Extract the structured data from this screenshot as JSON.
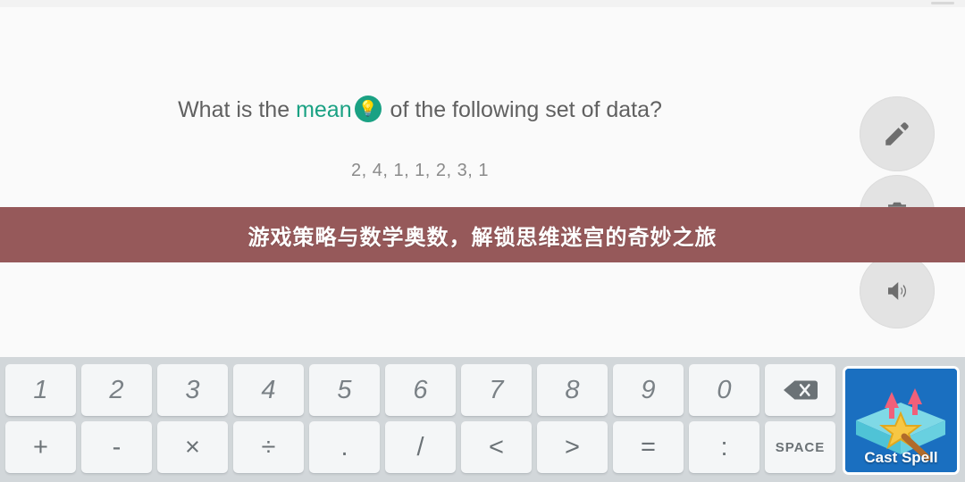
{
  "app": {
    "banner_text": "游戏策略与数学奥数，解锁思维迷宫的奇妙之旅",
    "banner_color": "#96595a",
    "accent_color": "#1aa183",
    "keypad_bg": "#d2d7da"
  },
  "question": {
    "prefix": "What is the ",
    "keyword": "mean",
    "suffix": " of the following set of data?",
    "hint_icon": "lightbulb-icon",
    "data_set": "2, 4, 1, 1, 2, 3, 1"
  },
  "answer": {
    "value": "",
    "placeholder": "",
    "hint_icon": "lightbulb-icon"
  },
  "side_actions": [
    {
      "name": "edit-button",
      "icon": "pencil-icon"
    },
    {
      "name": "delete-button",
      "icon": "trash-icon"
    },
    {
      "name": "sound-button",
      "icon": "speaker-icon"
    }
  ],
  "keypad": {
    "row1": [
      "1",
      "2",
      "3",
      "4",
      "5",
      "6",
      "7",
      "8",
      "9",
      "0"
    ],
    "backspace_icon": "backspace-icon",
    "row2": [
      "+",
      "-",
      "×",
      "÷",
      ".",
      "/",
      "<",
      ">",
      "=",
      ":"
    ],
    "space_label": "SPACE",
    "cast_spell_label": "Cast Spell",
    "cast_spell_icon": "magic-wand-icon"
  }
}
